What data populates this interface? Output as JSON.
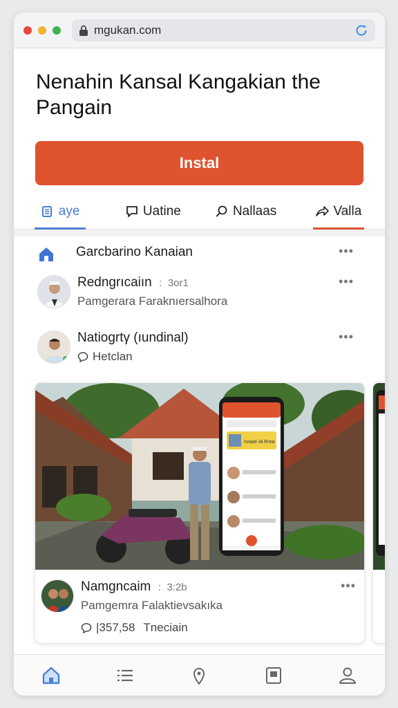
{
  "browser": {
    "url": "mgukan.com",
    "dot_colors": [
      "#e5483f",
      "#f2b230",
      "#3fb34f"
    ]
  },
  "page": {
    "title": "Nenahin Kansal Kangakian the Pangain",
    "install_label": "Instal"
  },
  "tabs": [
    {
      "label": "aye",
      "icon": "book-icon",
      "active": true,
      "underline": "#4a7fd4"
    },
    {
      "label": "Uatine",
      "icon": "chat-icon",
      "active": false
    },
    {
      "label": "Nallaas",
      "icon": "search-icon",
      "active": false
    },
    {
      "label": "Valla",
      "icon": "share-icon",
      "active": false,
      "underline": "#d9542f"
    }
  ],
  "feed": {
    "header": {
      "title": "Garcbarino Kanaian",
      "icon": "home-icon"
    },
    "items": [
      {
        "name": "Redngrıcaiın",
        "time": "3or1",
        "subtitle": "Pamgerara Faraknıersalhora"
      },
      {
        "name": "Natiogrtγ (ıundinal)",
        "subtitle": "Hetclan",
        "sub_icon": "chat-bubble-icon"
      }
    ],
    "card": {
      "name": "Namgncaim",
      "time": "3:2b",
      "subtitle": "Pamgemra Falaktievsakıka",
      "stats": "|357,58",
      "stats_label": "Tneciain",
      "phone_app": {
        "banner": "Iıvaaé IA Rrea"
      }
    }
  },
  "bottom_nav": [
    "home-icon",
    "list-icon",
    "map-pin-icon",
    "bookmark-icon",
    "profile-icon"
  ],
  "colors": {
    "accent": "#e0532f",
    "active_tab": "#4a7fd4",
    "nav_active": "#4a7fd4"
  }
}
